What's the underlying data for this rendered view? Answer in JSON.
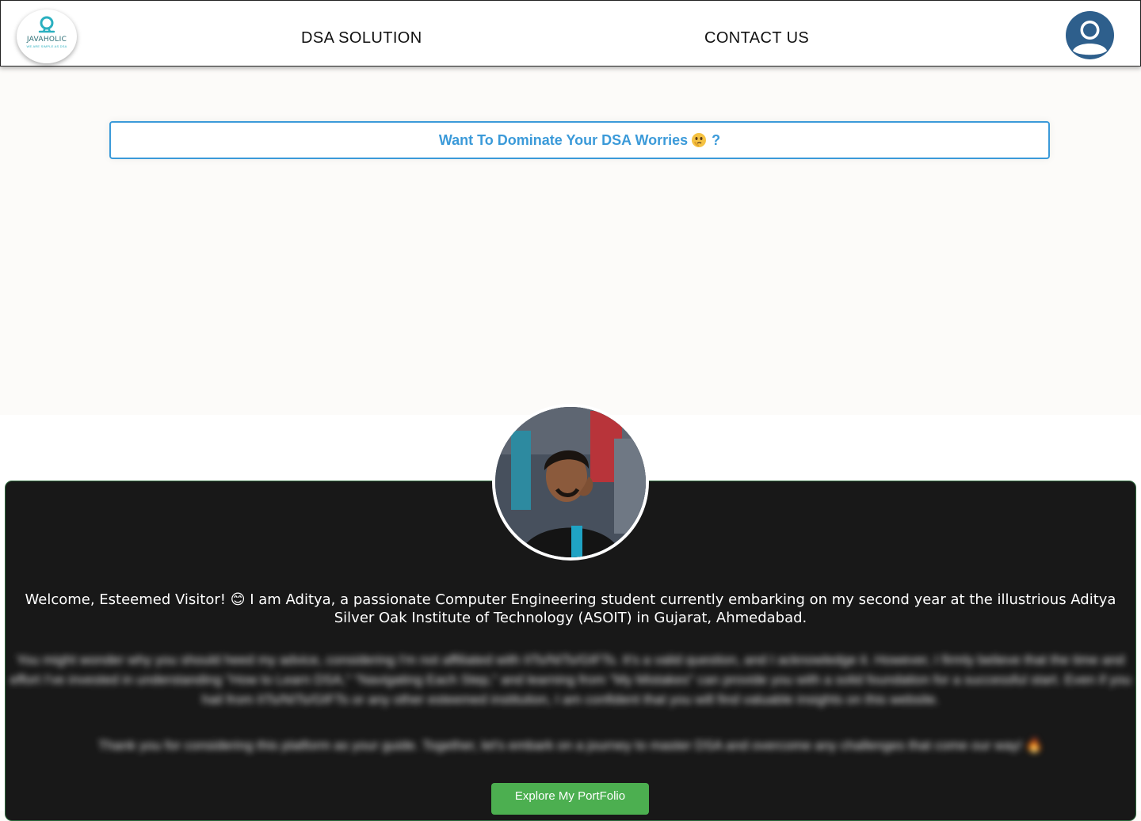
{
  "brand": {
    "name": "JAVAHOLIC",
    "tagline": "WE ARE SIMPLE AS DSA",
    "accent": "#2ab0c0"
  },
  "nav": {
    "items": [
      {
        "label": "DSA SOLUTION"
      },
      {
        "label": "CONTACT US"
      }
    ],
    "profile_icon": "user-avatar-icon"
  },
  "hero": {
    "button_label": "Want To Dominate Your DSA Worries",
    "button_suffix": "?",
    "emoji_icon": "thinking-face-icon",
    "color": "#3b9ad9"
  },
  "about": {
    "welcome_text": "Welcome, Esteemed Visitor! 😊 I am Aditya, a passionate Computer Engineering student currently embarking on my second year at the illustrious Aditya Silver Oak Institute of Technology (ASOIT) in Gujarat, Ahmedabad.",
    "paragraph": "You might wonder why you should heed my advice, considering I'm not affiliated with IITs/NITs/GIFTs. It's a valid question, and I acknowledge it. However, I firmly believe that the time and effort I've invested in understanding \"How to Learn DSA,\" \"Navigating Each Step,\" and learning from \"My Mistakes\" can provide you with a solid foundation for a successful start. Even if you hail from IITs/NITs/GIFTs or any other esteemed institution, I am confident that you will find valuable insights on this website.",
    "thanks": "Thank you for considering this platform as your guide. Together, let's embark on a journey to master DSA and overcome any challenges that come our way! 🔥",
    "portfolio_button": "Explore My PortFolio",
    "button_color": "#4caf50",
    "card_color": "#181818"
  }
}
